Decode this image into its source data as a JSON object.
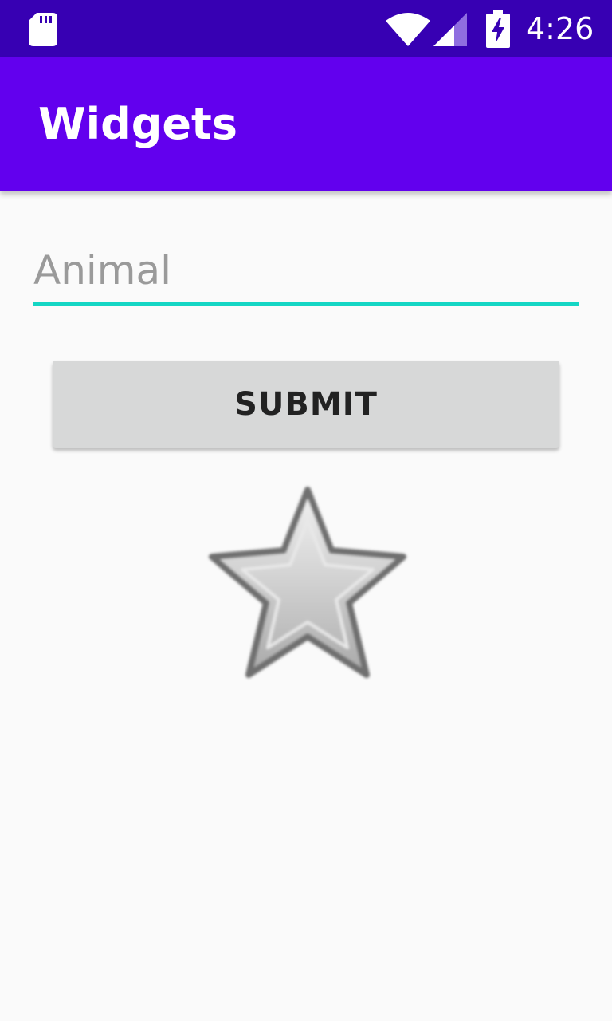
{
  "status_bar": {
    "time": "4:26",
    "icons": [
      "sd-card-icon",
      "wifi-icon",
      "cellular-signal-icon",
      "battery-charging-icon"
    ]
  },
  "app_bar": {
    "title": "Widgets",
    "color": "#6200ee"
  },
  "form": {
    "animal_field": {
      "placeholder": "Animal",
      "value": ""
    },
    "submit_label": "SUBMIT",
    "accent_color": "#14d6c4"
  },
  "star": {
    "icon": "star-icon",
    "state": "unchecked"
  }
}
